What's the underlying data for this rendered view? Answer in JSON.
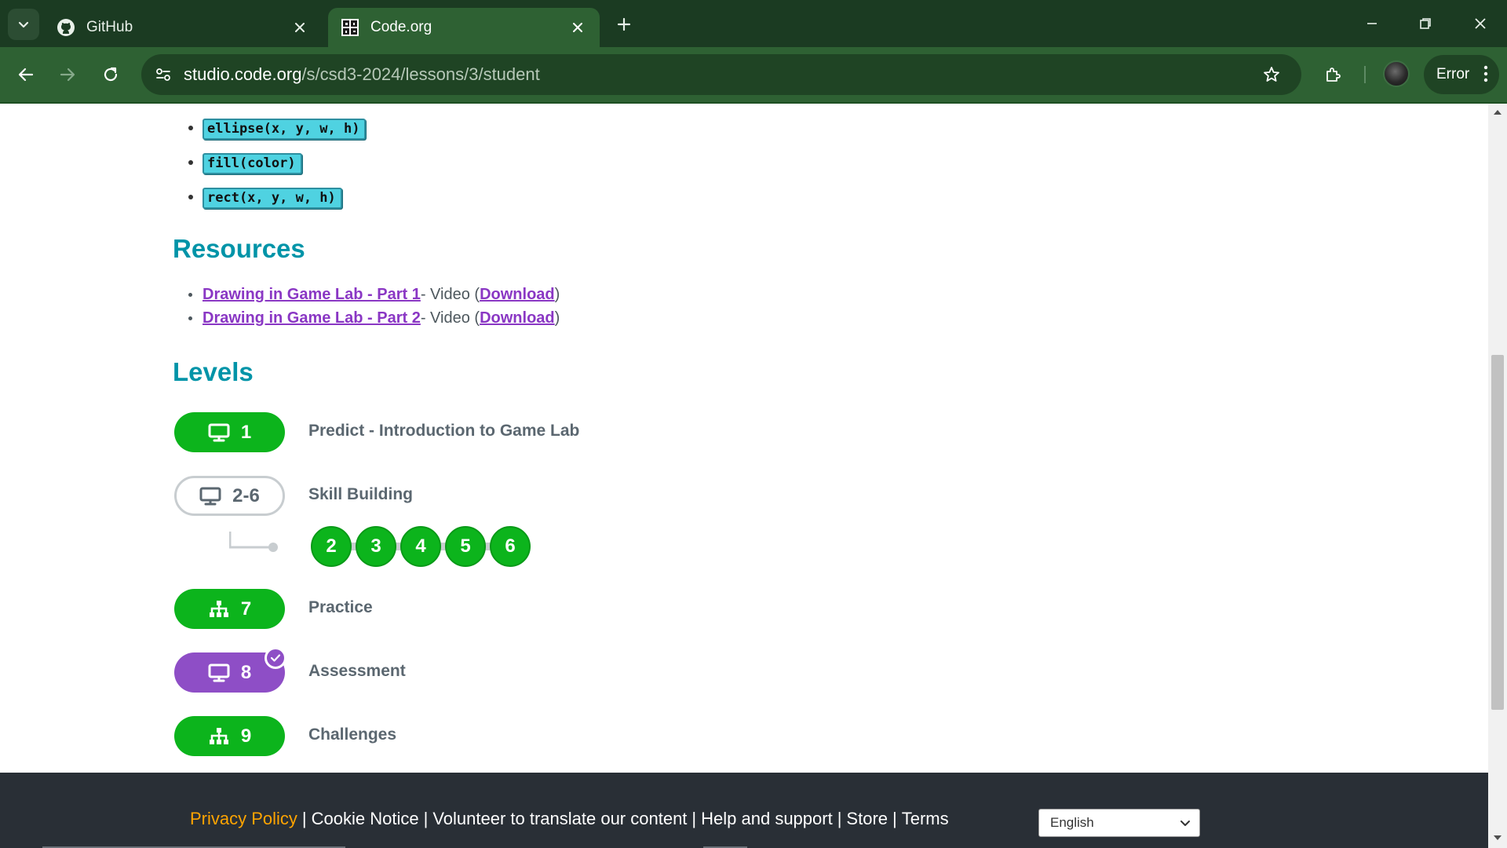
{
  "browser": {
    "tabs": [
      {
        "title": "GitHub",
        "favicon": "github-icon",
        "active": false
      },
      {
        "title": "Code.org",
        "favicon": "code-org-icon",
        "active": true
      }
    ],
    "url_host": "studio.code.org",
    "url_path": "/s/csd3-2024/lessons/3/student",
    "profile_status": "Error",
    "colors": {
      "tabbar": "#1b3b22",
      "toolbar": "#2e6133"
    }
  },
  "code_items": [
    "ellipse(x, y, w, h)",
    "fill(color)",
    "rect(x, y, w, h)"
  ],
  "resources": {
    "heading": "Resources",
    "items": [
      {
        "title": "Drawing in Game Lab - Part 1",
        "type": " - Video (",
        "download": "Download",
        "close": ")"
      },
      {
        "title": "Drawing in Game Lab - Part 2",
        "type": " - Video (",
        "download": "Download",
        "close": ")"
      }
    ]
  },
  "levels": {
    "heading": "Levels",
    "items": [
      {
        "number": "1",
        "label": "Predict - Introduction to Game Lab",
        "icon": "desktop-icon",
        "status": "completed",
        "color": "#0cb41c"
      },
      {
        "number": "2-6",
        "label": "Skill Building",
        "icon": "desktop-icon",
        "status": "not-started",
        "sublevels": [
          "2",
          "3",
          "4",
          "5",
          "6"
        ]
      },
      {
        "number": "7",
        "label": "Practice",
        "icon": "choice-icon",
        "status": "completed",
        "color": "#0cb41c"
      },
      {
        "number": "8",
        "label": "Assessment",
        "icon": "desktop-icon",
        "status": "submitted",
        "color": "#8e4ec6"
      },
      {
        "number": "9",
        "label": "Challenges",
        "icon": "choice-icon",
        "status": "completed",
        "color": "#0cb41c"
      }
    ]
  },
  "footer": {
    "links": [
      "Privacy Policy",
      "Cookie Notice",
      "Volunteer to translate our content",
      "Help and support",
      "Store",
      "Terms"
    ],
    "separator": "|",
    "language": "English",
    "colors": {
      "background": "#292f36",
      "privacy": "#ffa400"
    }
  }
}
